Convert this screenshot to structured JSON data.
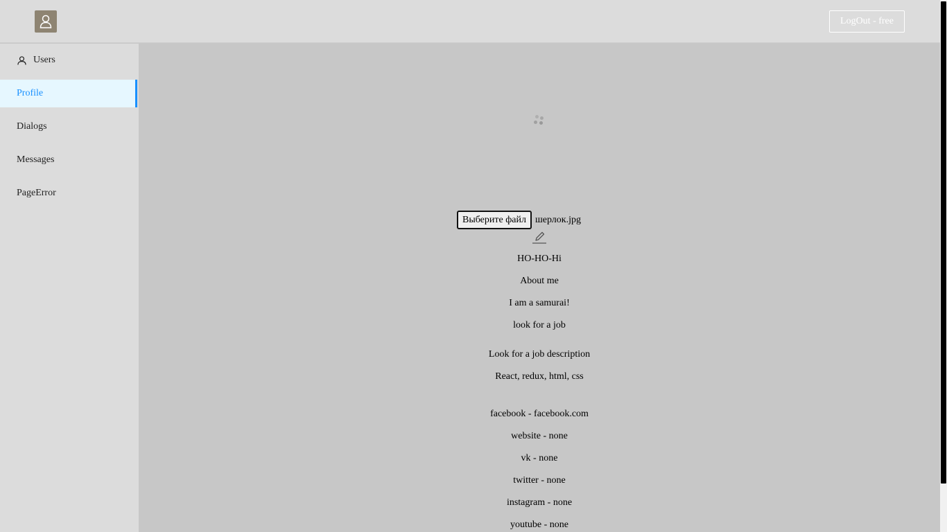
{
  "header": {
    "avatar_icon": "user-icon",
    "logout_label": "LogOut - free"
  },
  "sidebar": {
    "items": [
      {
        "label": "Users",
        "icon": "user-icon",
        "active": false
      },
      {
        "label": "Profile",
        "active": true
      },
      {
        "label": "Dialogs",
        "active": false
      },
      {
        "label": "Messages",
        "active": false
      },
      {
        "label": "PageError",
        "active": false
      }
    ],
    "active_color": "#1890ff",
    "active_bg": "#e6f7ff"
  },
  "profile": {
    "loading_icon": "spinner-icon",
    "file_button_label": "Выберите файл",
    "file_name": "шерлок.jpg",
    "edit_icon": "pencil-icon",
    "status": "HO-HO-Hi",
    "about_label": "About me",
    "about_text": "I am a samurai!",
    "job_label": "look for a job",
    "job_description_label": "Look for a job description",
    "job_description": "React, redux, html, css",
    "contacts": [
      "facebook - facebook.com",
      "website - none",
      "vk - none",
      "twitter - none",
      "instagram - none",
      "youtube - none"
    ]
  },
  "colors": {
    "header_bg": "#dcdcdc",
    "main_bg": "#c7c7c7",
    "avatar_bg": "#8e8472"
  }
}
